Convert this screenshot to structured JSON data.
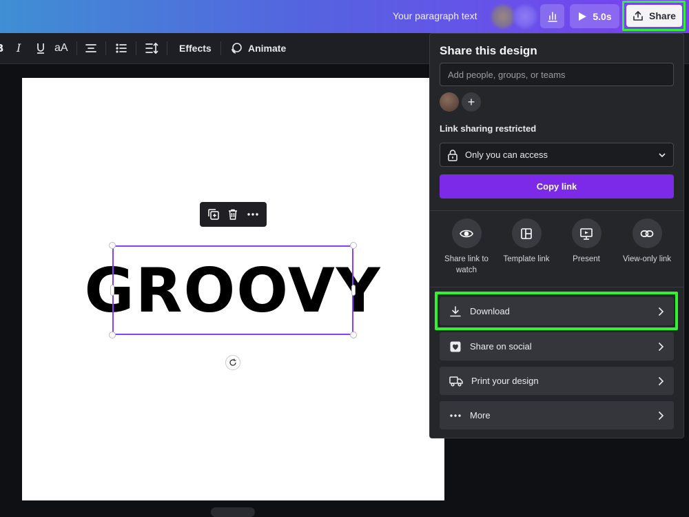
{
  "header": {
    "paragraph_text": "Your paragraph text",
    "play_duration": "5.0s",
    "share_label": "Share"
  },
  "toolbar": {
    "effects_label": "Effects",
    "animate_label": "Animate",
    "font_size_glyph": "aA"
  },
  "canvas": {
    "text_content": "GROOVY"
  },
  "share_panel": {
    "title": "Share this design",
    "people_placeholder": "Add people, groups, or teams",
    "add_button_glyph": "+",
    "link_sharing_label": "Link sharing restricted",
    "access_value": "Only you can access",
    "copy_link_label": "Copy link",
    "options": [
      {
        "label": "Share link to watch",
        "icon": "eye-icon"
      },
      {
        "label": "Template link",
        "icon": "template-icon"
      },
      {
        "label": "Present",
        "icon": "present-icon"
      },
      {
        "label": "View-only link",
        "icon": "link-icon"
      }
    ],
    "rows": [
      {
        "label": "Download",
        "icon": "download-icon"
      },
      {
        "label": "Share on social",
        "icon": "heart-icon"
      },
      {
        "label": "Print your design",
        "icon": "truck-icon"
      },
      {
        "label": "More",
        "icon": "more-icon"
      }
    ]
  },
  "colors": {
    "accent_purple": "#7d2ae8",
    "highlight_green": "#2ff52f",
    "selection_purple": "#8b3dff"
  }
}
